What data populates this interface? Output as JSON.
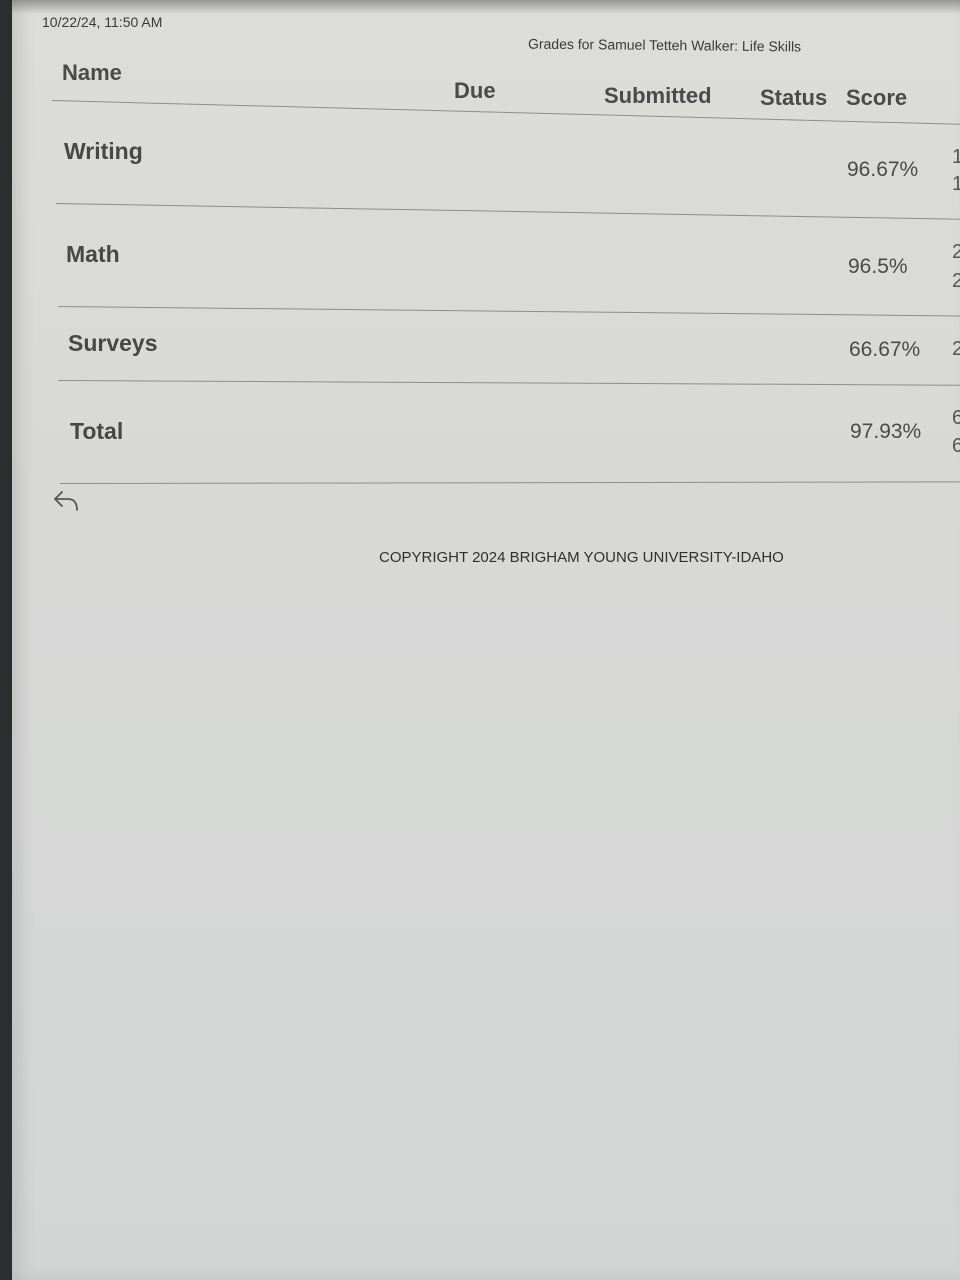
{
  "header": {
    "timestamp": "10/22/24, 11:50 AM",
    "title": "Grades for Samuel Tetteh Walker: Life Skills"
  },
  "table": {
    "columns": {
      "name": "Name",
      "due": "Due",
      "submitted": "Submitted",
      "status": "Status",
      "score": "Score"
    },
    "rows": [
      {
        "name": "Writing",
        "score": "96.67%"
      },
      {
        "name": "Math",
        "score": "96.5%"
      },
      {
        "name": "Surveys",
        "score": "66.67%"
      },
      {
        "name": "Total",
        "score": "97.93%"
      }
    ]
  },
  "footer": {
    "copyright": "COPYRIGHT 2024 BRIGHAM YOUNG UNIVERSITY-IDAHO"
  },
  "icons": {
    "back": "reply-arrow-icon"
  }
}
